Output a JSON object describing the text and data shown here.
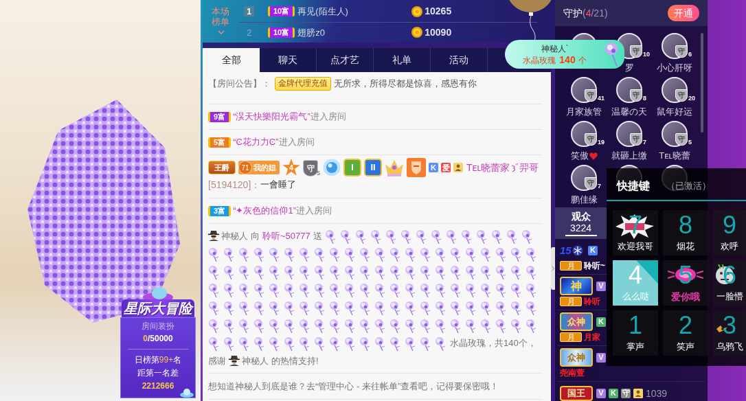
{
  "video_widget": {
    "title": "星际大冒险",
    "subtitle": "房间装扮",
    "progress_current": "0",
    "progress_total": "/50000",
    "rank_prefix": "日榜第",
    "rank_value": "99+",
    "rank_suffix": "名",
    "gap_label": "距第一名差",
    "gap_value": "2212666"
  },
  "ranking": {
    "label": "本场榜单",
    "rows": [
      {
        "rank": "1",
        "top": true,
        "badge": "10富",
        "name": "再见(陌生人)",
        "coins": "10265"
      },
      {
        "rank": "2",
        "top": false,
        "badge": "10富",
        "name": "翅膀z0",
        "coins": "10090"
      }
    ]
  },
  "tabs": [
    {
      "label": "全部",
      "selected": true
    },
    {
      "label": "聊天",
      "selected": false
    },
    {
      "label": "点才艺",
      "selected": false
    },
    {
      "label": "礼单",
      "selected": false
    },
    {
      "label": "活动",
      "selected": false
    }
  ],
  "chat": [
    {
      "kind": "notice",
      "label": "【房间公告】：",
      "tag": "金牌代理充值",
      "text": "无所求，所得尽都是惊喜，感恩有你"
    },
    {
      "kind": "enter",
      "badge": "9富",
      "color": "#9b2be0",
      "name": "“淏天快樂阳光霸气”",
      "text": "进入房间"
    },
    {
      "kind": "enter",
      "badge": "5富",
      "color": "#f07c22",
      "name": "“Ͼ花力力Ͼ”",
      "text": "进入房间"
    },
    {
      "kind": "talk",
      "badges": [
        {
          "kind": "title",
          "text": "王爵"
        },
        {
          "kind": "fan",
          "number": "71",
          "text": "我的妞"
        },
        {
          "kind": "star",
          "text": "4"
        },
        {
          "kind": "guard",
          "text": "守",
          "number": "5"
        },
        {
          "kind": "orb"
        },
        {
          "kind": "medal",
          "color": "#5fae3a",
          "text": "I"
        },
        {
          "kind": "medal",
          "color": "#2f74d8",
          "text": "II"
        },
        {
          "kind": "crown"
        },
        {
          "kind": "shield"
        },
        {
          "kind": "letter",
          "color": "#5b8ff9",
          "text": "K"
        },
        {
          "kind": "letter",
          "color": "#f04848",
          "text": "爱"
        },
        {
          "kind": "person"
        }
      ],
      "name": "Tᴇʟ晓蕾家",
      "name_tail": "羿哥",
      "uid": "[5194120]：",
      "text": "一會睡了"
    },
    {
      "kind": "enter",
      "badge": "3富",
      "color": "#1a9be8",
      "name": "“✦灰色的信仰1”",
      "text": "进入房间"
    },
    {
      "kind": "gift",
      "sender": "神秘人",
      "to": "向",
      "receiver": "聆听~50777",
      "verb": "送",
      "summary": "水晶玫瑰，共140个，",
      "thanks": "感谢",
      "thanks_name": "神秘人",
      "thanks_end": "的热情支持!"
    },
    {
      "kind": "system",
      "text": "想知道神秘人到底是谁？去“管理中心 - 来往帐单”查看吧，记得要保密哦！"
    }
  ],
  "notification": {
    "sender": "神秘人`",
    "gift": "水晶玫瑰",
    "count": "140",
    "unit": "个"
  },
  "guard": {
    "title": "守护",
    "count_open": "(",
    "count_active": "4",
    "count_rest": "/21)",
    "button": "开通",
    "members": [
      {
        "kind": "plain"
      },
      {
        "kind": "plain",
        "badge": "守",
        "badge_number": "10",
        "name": "罗"
      },
      {
        "kind": "plain",
        "badge": "守",
        "badge_number": "6",
        "name": "小心肝呀"
      },
      {
        "kind": "plain",
        "badge": "守",
        "badge_number": "41",
        "name": "月家族管"
      },
      {
        "kind": "plain",
        "badge": "守",
        "badge_number": "8",
        "name": "温馨の天"
      },
      {
        "kind": "plain",
        "badge": "守",
        "badge_number": "20",
        "name": "鼠年好运"
      },
      {
        "kind": "heart",
        "badge": "守",
        "badge_number": "19",
        "name": "笑傲"
      },
      {
        "kind": "plain",
        "badge": "守",
        "badge_number": "7",
        "name": "就砸上缴"
      },
      {
        "kind": "plain",
        "badge": "守",
        "badge_number": "5",
        "name": "Tᴇʟ晓蕾"
      },
      {
        "kind": "plain",
        "badge": "守",
        "badge_number": "7",
        "name": "鹏佳缘"
      },
      {
        "kind": "plain"
      },
      {
        "kind": "plain"
      }
    ]
  },
  "audience": {
    "tab": {
      "label": "观众",
      "count": "3224",
      "selected": true
    },
    "rows": [
      {
        "rank": {
          "kind": "level",
          "text": "15"
        },
        "tags": [
          {
            "kind": "letter",
            "text": "K",
            "color": "#4f86f7"
          }
        ],
        "month": "月",
        "name": "聆听~",
        "color": "#ffffff"
      },
      {
        "rank": {
          "kind": "god",
          "text": "神"
        },
        "tags": [
          {
            "kind": "letter",
            "text": "V",
            "color": "#a57be6"
          }
        ],
        "month": "月",
        "name": "聆听",
        "color": "#ff2020"
      },
      {
        "rank": {
          "kind": "gods",
          "text": "众神"
        },
        "tags": [
          {
            "kind": "letter",
            "text": "K",
            "color": "#4fb36a"
          }
        ],
        "month": "月",
        "name": "月家",
        "color": "#ff2020"
      },
      {
        "rank": {
          "kind": "deity",
          "text": "众神"
        },
        "tags": [
          {
            "kind": "letter",
            "text": "V",
            "color": "#a57be6"
          }
        ],
        "name": "尧南萱",
        "color": "#ff2020"
      },
      {
        "rank": {
          "kind": "king",
          "text": "国王"
        },
        "tags": [
          {
            "kind": "letter",
            "text": "V",
            "color": "#a57be6"
          },
          {
            "kind": "letter",
            "text": "K",
            "color": "#4fb36a"
          },
          {
            "kind": "letter",
            "text": "守",
            "color": "#8c8c8c"
          },
          {
            "kind": "person"
          }
        ],
        "id": "1039"
      }
    ]
  },
  "shortcuts": {
    "title": "快捷键",
    "status": "（已激活）",
    "tiles": [
      {
        "number": "7",
        "label": "欢迎我哥",
        "kind": "burst",
        "selected": false
      },
      {
        "number": "8",
        "label": "烟花",
        "kind": "plain",
        "selected": false
      },
      {
        "number": "9",
        "label": "欢呼",
        "kind": "plain",
        "selected": false
      },
      {
        "number": "4",
        "label": "么么哒",
        "kind": "plain",
        "selected": true
      },
      {
        "number": "5",
        "label": "爱你哦",
        "kind": "hearts",
        "selected": false
      },
      {
        "number": "6",
        "label": "一脸懵",
        "kind": "face",
        "selected": false
      },
      {
        "number": "1",
        "label": "掌声",
        "kind": "plain",
        "selected": false
      },
      {
        "number": "2",
        "label": "笑声",
        "kind": "plain",
        "selected": false
      },
      {
        "number": "3",
        "label": "乌鸦飞",
        "kind": "crow",
        "selected": false
      }
    ]
  }
}
